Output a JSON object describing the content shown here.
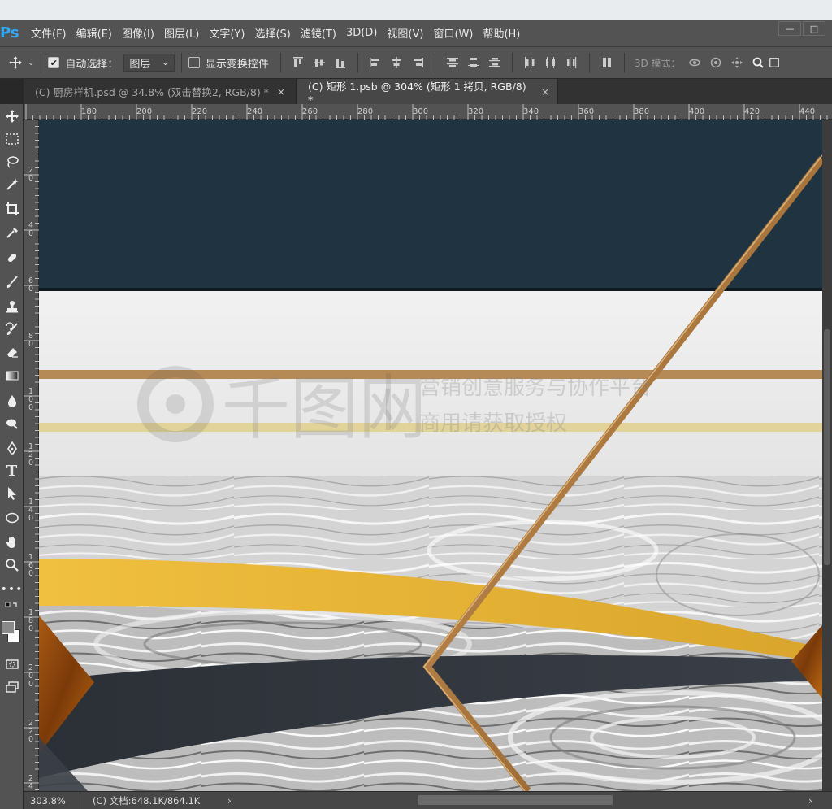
{
  "app": {
    "logo": "Ps"
  },
  "menu": [
    {
      "label": "文件(F)"
    },
    {
      "label": "编辑(E)"
    },
    {
      "label": "图像(I)"
    },
    {
      "label": "图层(L)"
    },
    {
      "label": "文字(Y)"
    },
    {
      "label": "选择(S)"
    },
    {
      "label": "滤镜(T)"
    },
    {
      "label": "3D(D)"
    },
    {
      "label": "视图(V)"
    },
    {
      "label": "窗口(W)"
    },
    {
      "label": "帮助(H)"
    }
  ],
  "window_controls": {
    "minimize": "—",
    "maximize": "□"
  },
  "options": {
    "auto_select_label": "自动选择：",
    "auto_select_checked": true,
    "auto_select_value": "图层",
    "show_transform_label": "显示变换控件",
    "mode_label": "3D 模式："
  },
  "tabs": [
    {
      "label": "(C) 厨房样机.psd @ 34.8% (双击替换2, RGB/8) *",
      "active": false,
      "close": "×"
    },
    {
      "label": "(C) 矩形 1.psb @ 304% (矩形 1 拷贝, RGB/8) *",
      "active": true,
      "close": "×"
    }
  ],
  "ruler": {
    "h_ticks": [
      "180",
      "200",
      "220",
      "240",
      "260",
      "280",
      "300",
      "320",
      "340",
      "360",
      "380",
      "400",
      "420",
      "440"
    ],
    "v_ticks": [
      "20",
      "40",
      "60",
      "80",
      "100",
      "120",
      "140",
      "160",
      "180",
      "200",
      "220",
      "240"
    ]
  },
  "watermark": {
    "logo_text": "千图网",
    "line1": "营销创意服务与协作平台",
    "line2": "商用请获取授权"
  },
  "status": {
    "zoom": "303.8%",
    "doc": "(C) 文档:648.1K/864.1K",
    "arrow": "›"
  },
  "colors": {
    "navy": "#1f3341",
    "gold": "#e3b43b",
    "copper": "#b07d45",
    "dark_band": "#2c3138"
  }
}
